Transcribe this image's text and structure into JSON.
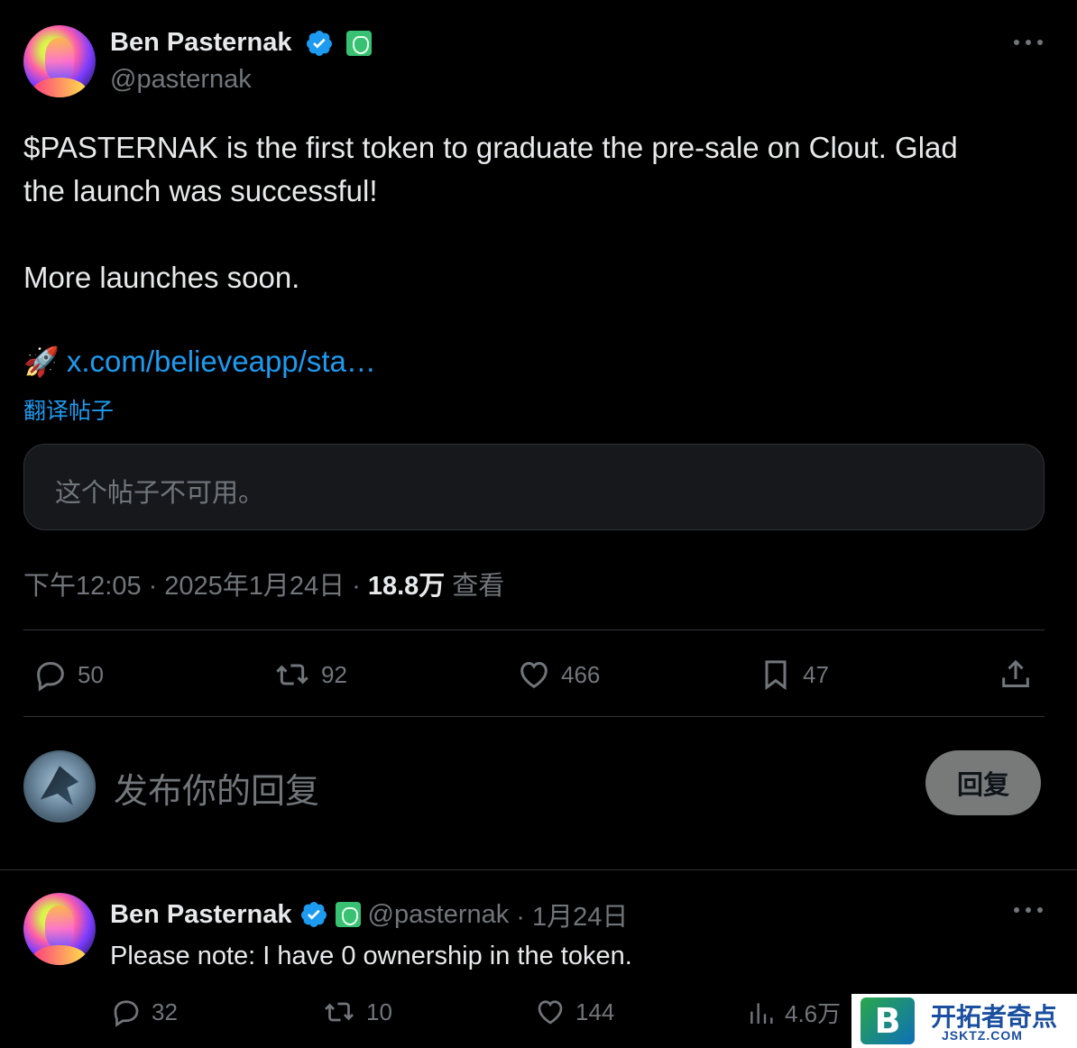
{
  "post": {
    "author_name": "Ben Pasternak",
    "author_handle": "@pasternak",
    "text_line1": "$PASTERNAK is the first token to graduate the pre-sale on Clout. Glad",
    "text_line2": "the launch was successful!",
    "text_line3": "More launches soon.",
    "link_text": "x.com/believeapp/sta…",
    "link_emoji": "🚀",
    "translate_label": "翻译帖子",
    "quoted_unavailable": "这个帖子不可用。",
    "time": "下午12:05",
    "date": "2025年1月24日",
    "views_count": "18.8万",
    "views_label": "查看",
    "sep": "·"
  },
  "actions": {
    "replies": "50",
    "reposts": "92",
    "likes": "466",
    "bookmarks": "47"
  },
  "compose": {
    "placeholder": "发布你的回复",
    "reply_button": "回复"
  },
  "reply": {
    "author_name": "Ben Pasternak",
    "author_handle": "@pasternak",
    "date": "· 1月24日",
    "text": "Please note: I have 0 ownership in the token.",
    "replies": "32",
    "reposts": "10",
    "likes": "144",
    "views": "4.6万"
  },
  "watermark": {
    "logo": "B",
    "title": "开拓者奇点",
    "subtitle": "JSKTZ.COM"
  },
  "colors": {
    "background": "#000000",
    "text": "#e7e9ea",
    "muted": "#71767b",
    "link": "#1d9bf0",
    "verified": "#1d9bf0",
    "divider": "#2f3336"
  }
}
